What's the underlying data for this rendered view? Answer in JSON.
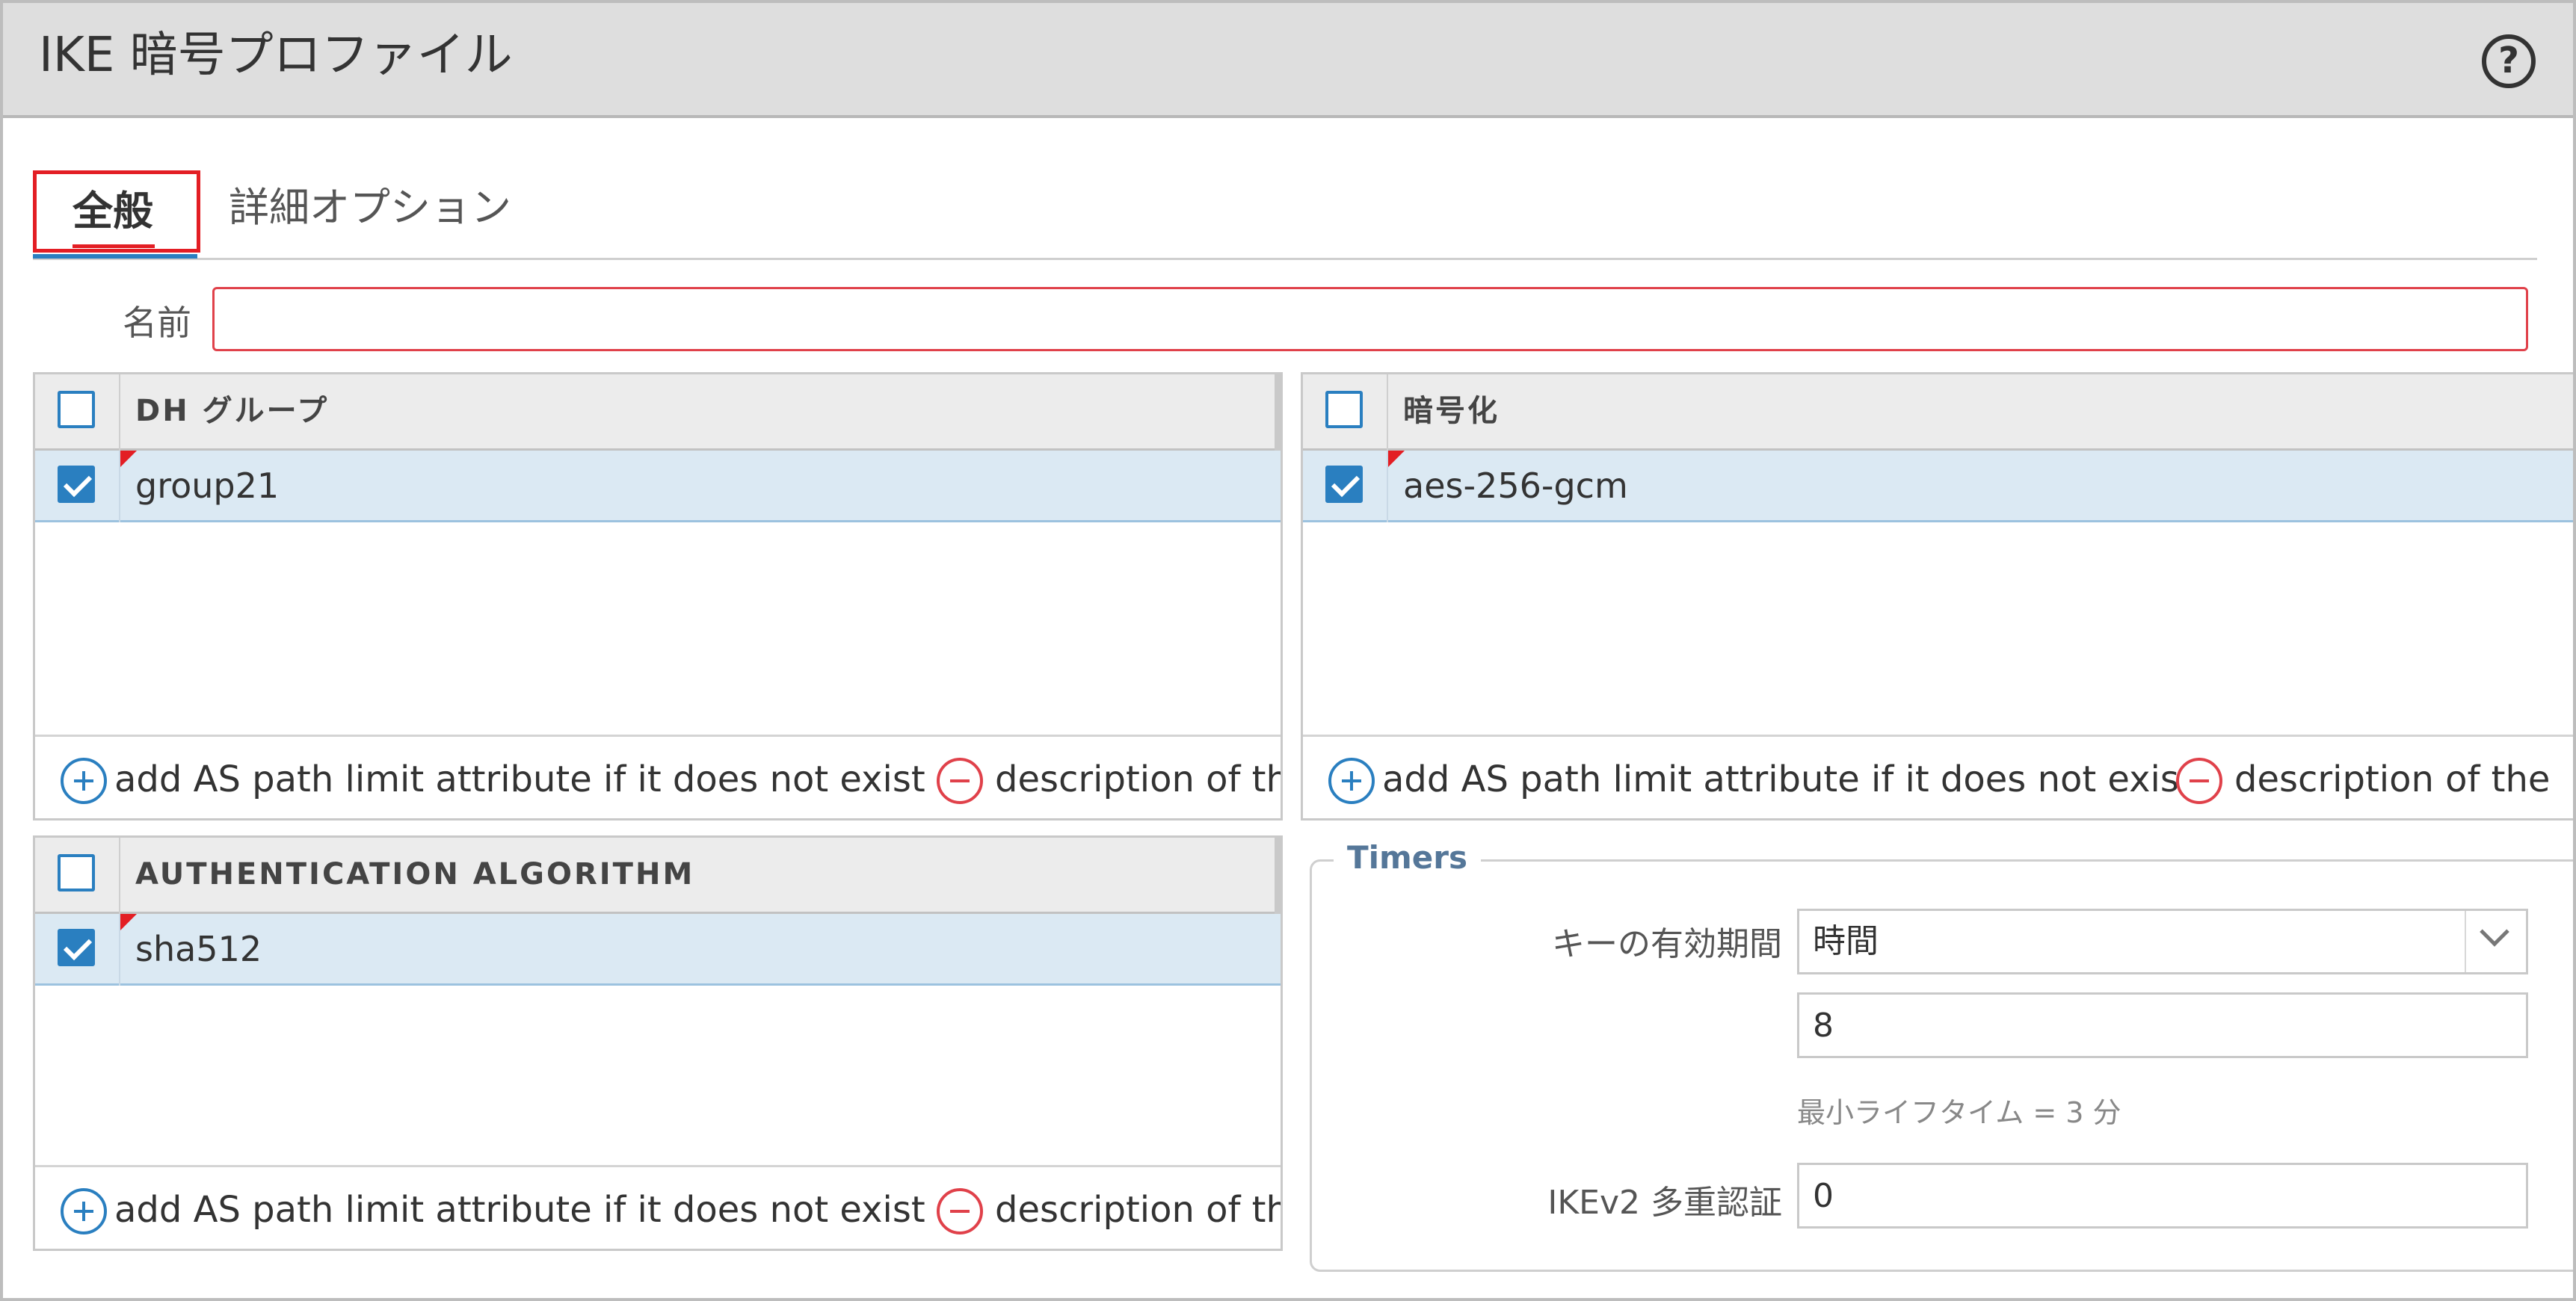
{
  "dialog": {
    "title": "IKE 暗号プロファイル",
    "help_icon": "question-circle-icon",
    "help_glyph": "?"
  },
  "tabs": [
    {
      "label": "全般",
      "active": true
    },
    {
      "label": "詳細オプション",
      "active": false
    }
  ],
  "name_field": {
    "label": "名前",
    "value": ""
  },
  "dh_group": {
    "header": "DH グループ",
    "rows": [
      {
        "value": "group21",
        "checked": true
      }
    ],
    "add_label": "add AS path limit attribute if it does not exist",
    "delete_label": "description of the g"
  },
  "encryption": {
    "header": "暗号化",
    "rows": [
      {
        "value": "aes-256-gcm",
        "checked": true
      }
    ],
    "add_label": "add AS path limit attribute if it does not exist",
    "delete_label": "description of the"
  },
  "authentication": {
    "header": "AUTHENTICATION ALGORITHM",
    "rows": [
      {
        "value": "sha512",
        "checked": true
      }
    ],
    "add_label": "add AS path limit attribute if it does not exist",
    "delete_label": "description of the g"
  },
  "timers": {
    "legend": "Timers",
    "key_lifetime_label": "キーの有効期間",
    "key_lifetime_unit": "時間",
    "key_lifetime_value": "8",
    "min_lifetime_hint": "最小ライフタイム = 3 分",
    "ikev2_auth_label": "IKEv2 多重認証",
    "ikev2_auth_value": "0"
  },
  "colors": {
    "accent": "#2a7fc0",
    "error": "#e31e24",
    "selected_row": "#dbe9f3"
  }
}
